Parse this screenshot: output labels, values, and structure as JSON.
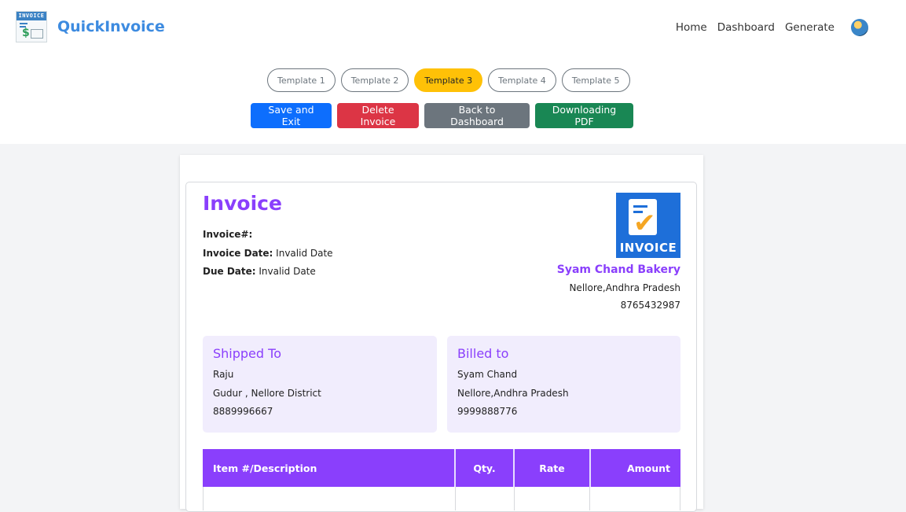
{
  "nav": {
    "brand": "QuickInvoice",
    "logo_text": "INVOICE",
    "logo_symbol": "$",
    "links": [
      "Home",
      "Dashboard",
      "Generate"
    ]
  },
  "templates": {
    "items": [
      "Template 1",
      "Template 2",
      "Template 3",
      "Template 4",
      "Template 5"
    ],
    "active": "Template 3"
  },
  "actions": {
    "save": "Save and Exit",
    "delete": "Delete Invoice",
    "back": "Back to Dashboard",
    "pdf": "Downloading PDF"
  },
  "invoice": {
    "title": "Invoice",
    "number_label": "Invoice#:",
    "number_value": "",
    "date_label": "Invoice Date:",
    "date_value": " Invalid Date",
    "due_label": "Due Date:",
    "due_value": " Invalid Date",
    "logo_label": "INVOICE",
    "business": {
      "name": "Syam Chand Bakery",
      "address": "Nellore,Andhra Pradesh",
      "phone": "8765432987"
    },
    "shipped_to": {
      "title": "Shipped To",
      "name": "Raju",
      "address": "Gudur , Nellore District",
      "phone": "8889996667"
    },
    "billed_to": {
      "title": "Billed to",
      "name": "Syam Chand",
      "address": "Nellore,Andhra Pradesh",
      "phone": "9999888776"
    },
    "table": {
      "headers": [
        "Item #/Description",
        "Qty.",
        "Rate",
        "Amount"
      ]
    }
  },
  "colors": {
    "accent": "#8a3ffc",
    "brand": "#3d8be0",
    "active_template": "#ffc107",
    "save": "#0d6efd",
    "delete": "#dc3545",
    "back": "#6c757d",
    "pdf": "#198754"
  }
}
